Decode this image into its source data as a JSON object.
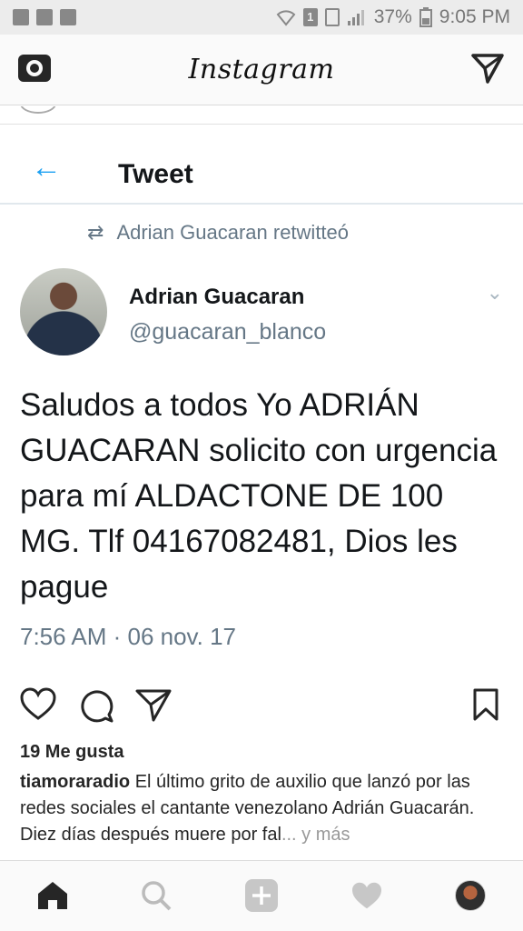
{
  "status_bar": {
    "battery": "37%",
    "time": "9:05 PM",
    "sim": "1"
  },
  "header": {
    "logo": "Instagram",
    "icons": [
      "camera-icon",
      "direct-message-icon"
    ]
  },
  "post": {
    "tweet": {
      "nav_title": "Tweet",
      "retweet_label": "Adrian Guacaran retwitteó",
      "author_name": "Adrian Guacaran",
      "author_handle": "@guacaran_blanco",
      "text": "Saludos a todos Yo ADRIÁN GUACARAN solicito con urgencia para mí ALDACTONE DE 100 MG. Tlf 04167082481, Dios les pague",
      "timestamp": "7:56 AM · 06 nov. 17",
      "accent_color": "#1da1f2"
    },
    "likes": "19 Me gusta",
    "caption_user": "tiamoraradio",
    "caption_text": "El último grito de auxilio que lanzó por las redes sociales el cantante venezolano Adrián Guacarán. Diez días después muere por fal",
    "caption_more": "... y más"
  },
  "bottom_nav": [
    "home-icon",
    "search-icon",
    "add-icon",
    "activity-heart-icon",
    "profile-avatar"
  ]
}
